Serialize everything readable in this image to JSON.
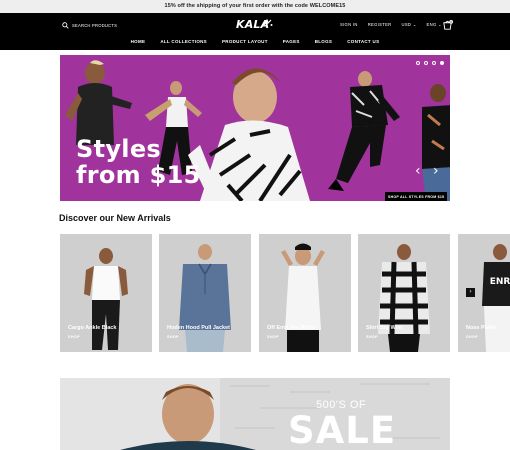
{
  "announcement": "15% off the shipping of your first order with the code WELCOME15",
  "header": {
    "search_placeholder": "SEARCH PRODUCTS",
    "logo": "KALA",
    "sign_in": "SIGN IN",
    "register": "REGISTER",
    "currency": "USD ⌄",
    "language": "ENG ⌄",
    "cart_count": "0"
  },
  "nav": [
    "HOME",
    "ALL COLLECTIONS",
    "PRODUCT LAYOUT",
    "PAGES",
    "BLOGS",
    "CONTACT US"
  ],
  "hero": {
    "headline_line1": "Styles",
    "headline_line2": "from $15",
    "cta": "SHOP ALL STYLES FROM $15",
    "prev_arrow": "‹",
    "next_arrow": "›"
  },
  "arrivals": {
    "title": "Discover our New Arrivals",
    "next_arrow": "›",
    "products": [
      {
        "title": "Cargo Ankle Black",
        "shop": "SHOP"
      },
      {
        "title": "Hoden Hood Pull Jacket",
        "shop": "SHOP"
      },
      {
        "title": "Off Emb Tee White",
        "shop": "SHOP"
      },
      {
        "title": "Shirt Big Whit",
        "shop": "SHOP"
      },
      {
        "title": "Nose Puller",
        "shop": "SHOP"
      }
    ]
  },
  "banner": {
    "subtitle": "500'S OF",
    "headline": "SALE"
  },
  "colors": {
    "hero_bg": "#a0339c",
    "header_bg": "#000000",
    "card_bg": "#cfcfcf"
  }
}
